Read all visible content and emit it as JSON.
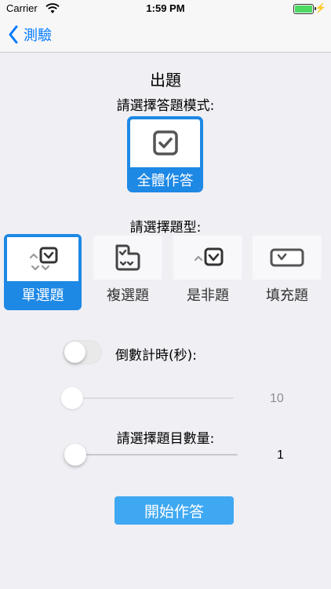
{
  "status_bar": {
    "carrier": "Carrier",
    "time": "1:59 PM"
  },
  "nav": {
    "back_label": "測驗"
  },
  "header": {
    "title": "出題",
    "mode_prompt": "請選擇答題模式:",
    "type_prompt": "請選擇題型:"
  },
  "mode_option": {
    "label": "全體作答",
    "icon": "checkbox-checked-icon",
    "selected": true
  },
  "question_types": [
    {
      "label": "單選題",
      "icon": "single-choice-icon",
      "selected": true
    },
    {
      "label": "複選題",
      "icon": "multiple-choice-icon",
      "selected": false
    },
    {
      "label": "是非題",
      "icon": "true-false-icon",
      "selected": false
    },
    {
      "label": "填充題",
      "icon": "fill-in-icon",
      "selected": false
    }
  ],
  "timer": {
    "label": "倒數計時(秒):",
    "enabled": false,
    "value": "10"
  },
  "question_count": {
    "label": "請選擇題目數量:",
    "value": "1"
  },
  "start_button": {
    "label": "開始作答"
  },
  "colors": {
    "accent": "#1e88e5",
    "button": "#3fa8f2",
    "link": "#007aff",
    "background": "#efeff4"
  }
}
